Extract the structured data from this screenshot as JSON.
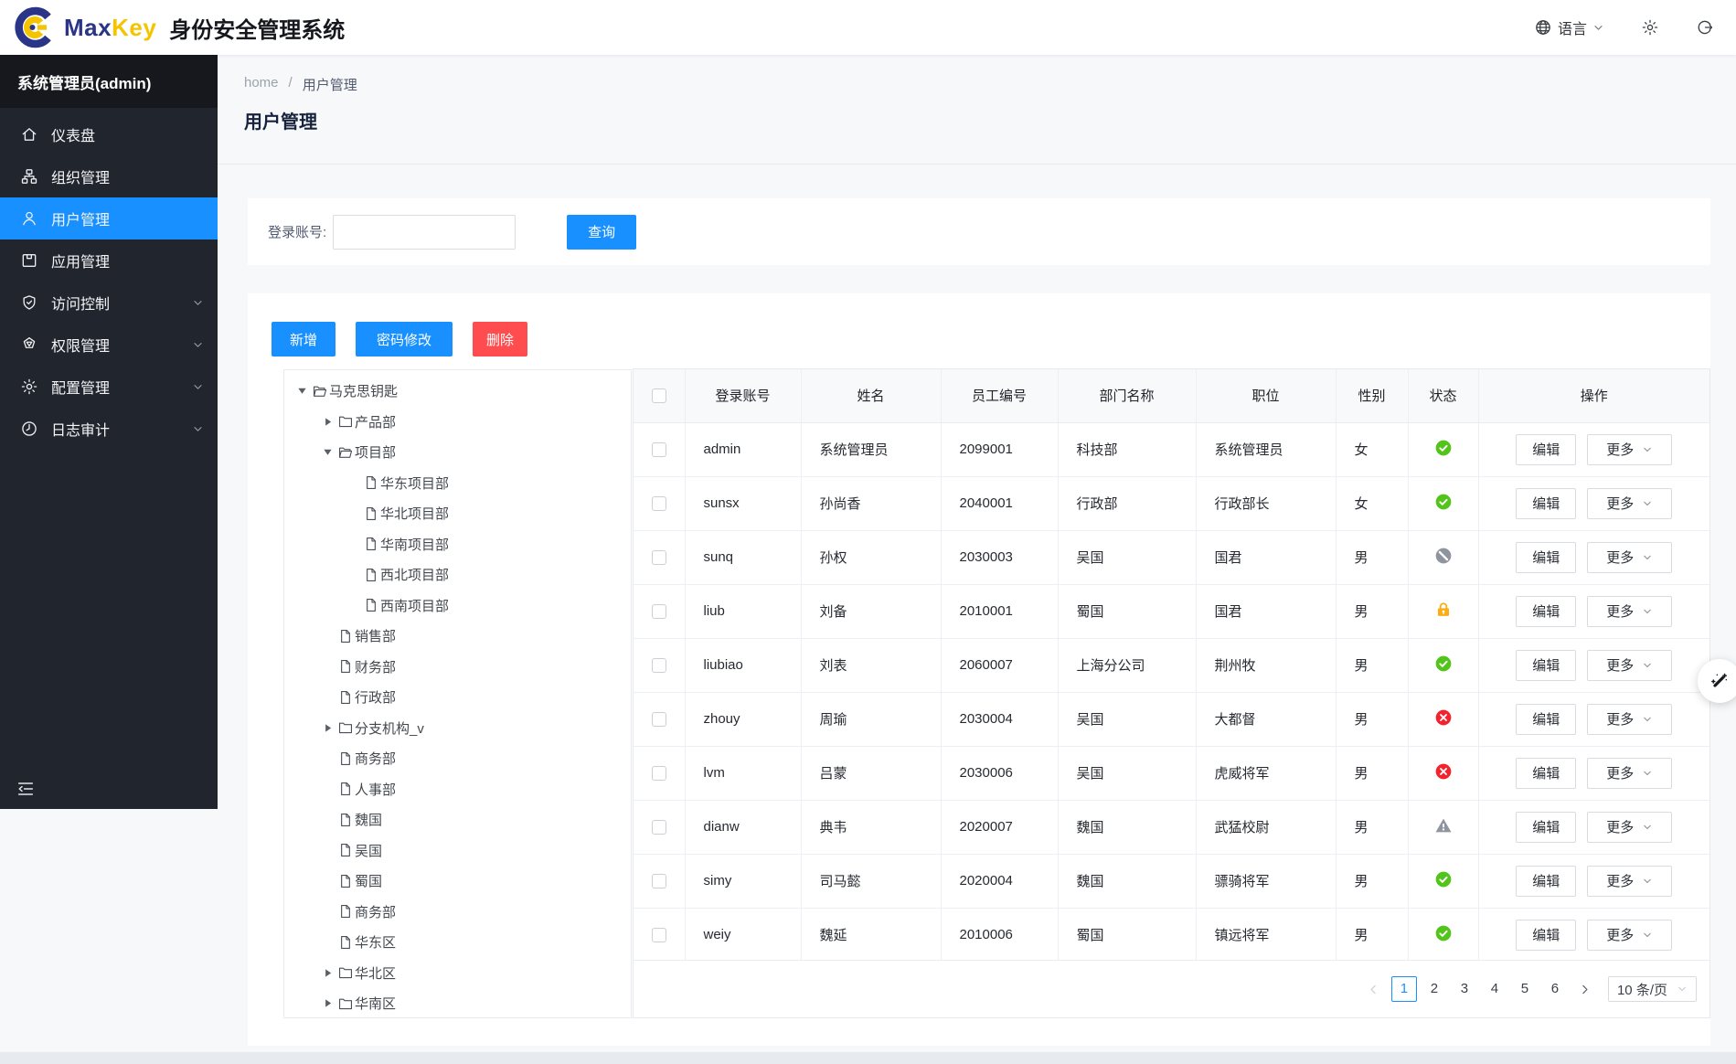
{
  "header": {
    "brand": {
      "max": "Max",
      "key": "Key",
      "product": "身份安全管理系统"
    },
    "language": {
      "label": "语言"
    }
  },
  "sidebar": {
    "user_title": "系统管理员(admin)",
    "items": [
      {
        "label": "仪表盘",
        "icon": "dashboard-icon",
        "active": false,
        "chevron": false
      },
      {
        "label": "组织管理",
        "icon": "organization-icon",
        "active": false,
        "chevron": false
      },
      {
        "label": "用户管理",
        "icon": "user-icon",
        "active": true,
        "chevron": false
      },
      {
        "label": "应用管理",
        "icon": "app-icon",
        "active": false,
        "chevron": false
      },
      {
        "label": "访问控制",
        "icon": "shield-icon",
        "active": false,
        "chevron": true
      },
      {
        "label": "权限管理",
        "icon": "gem-icon",
        "active": false,
        "chevron": true
      },
      {
        "label": "配置管理",
        "icon": "config-gear-icon",
        "active": false,
        "chevron": true
      },
      {
        "label": "日志审计",
        "icon": "clock-icon",
        "active": false,
        "chevron": true
      }
    ]
  },
  "breadcrumb": {
    "home": "home",
    "separator": "/",
    "current": "用户管理"
  },
  "page_title": "用户管理",
  "search": {
    "label": "登录账号:",
    "input_value": "",
    "button": "查询"
  },
  "toolbar": [
    {
      "label": "新增",
      "type": "primary"
    },
    {
      "label": "密码修改",
      "type": "primary"
    },
    {
      "label": "删除",
      "type": "danger"
    }
  ],
  "tree": {
    "nodes": [
      {
        "label": "马克思钥匙",
        "level": 0,
        "caret": "open",
        "icon": "folder-open-icon"
      },
      {
        "label": "产品部",
        "level": 1,
        "caret": "closed",
        "icon": "folder-closed-icon"
      },
      {
        "label": "项目部",
        "level": 1,
        "caret": "open",
        "icon": "folder-open-icon"
      },
      {
        "label": "华东项目部",
        "level": 2,
        "caret": "none",
        "icon": "file-icon"
      },
      {
        "label": "华北项目部",
        "level": 2,
        "caret": "none",
        "icon": "file-icon"
      },
      {
        "label": "华南项目部",
        "level": 2,
        "caret": "none",
        "icon": "file-icon"
      },
      {
        "label": "西北项目部",
        "level": 2,
        "caret": "none",
        "icon": "file-icon"
      },
      {
        "label": "西南项目部",
        "level": 2,
        "caret": "none",
        "icon": "file-icon"
      },
      {
        "label": "销售部",
        "level": 1,
        "caret": "none",
        "icon": "file-icon"
      },
      {
        "label": "财务部",
        "level": 1,
        "caret": "none",
        "icon": "file-icon"
      },
      {
        "label": "行政部",
        "level": 1,
        "caret": "none",
        "icon": "file-icon"
      },
      {
        "label": "分支机构_v",
        "level": 1,
        "caret": "closed",
        "icon": "folder-closed-icon"
      },
      {
        "label": "商务部",
        "level": 1,
        "caret": "none",
        "icon": "file-icon"
      },
      {
        "label": "人事部",
        "level": 1,
        "caret": "none",
        "icon": "file-icon"
      },
      {
        "label": "魏国",
        "level": 1,
        "caret": "none",
        "icon": "file-icon"
      },
      {
        "label": "吴国",
        "level": 1,
        "caret": "none",
        "icon": "file-icon"
      },
      {
        "label": "蜀国",
        "level": 1,
        "caret": "none",
        "icon": "file-icon"
      },
      {
        "label": "商务部",
        "level": 1,
        "caret": "none",
        "icon": "file-icon"
      },
      {
        "label": "华东区",
        "level": 1,
        "caret": "none",
        "icon": "file-icon"
      },
      {
        "label": "华北区",
        "level": 1,
        "caret": "closed",
        "icon": "folder-closed-icon"
      },
      {
        "label": "华南区",
        "level": 1,
        "caret": "closed",
        "icon": "folder-closed-icon"
      }
    ]
  },
  "table": {
    "headers": [
      "登录账号",
      "姓名",
      "员工编号",
      "部门名称",
      "职位",
      "性别",
      "状态",
      "操作"
    ],
    "edit_label": "编辑",
    "more_label": "更多",
    "rows": [
      {
        "account": "admin",
        "name": "系统管理员",
        "employee_no": "2099001",
        "department": "科技部",
        "position": "系统管理员",
        "gender": "女",
        "status": "active"
      },
      {
        "account": "sunsx",
        "name": "孙尚香",
        "employee_no": "2040001",
        "department": "行政部",
        "position": "行政部长",
        "gender": "女",
        "status": "active"
      },
      {
        "account": "sunq",
        "name": "孙权",
        "employee_no": "2030003",
        "department": "吴国",
        "position": "国君",
        "gender": "男",
        "status": "disabled"
      },
      {
        "account": "liub",
        "name": "刘备",
        "employee_no": "2010001",
        "department": "蜀国",
        "position": "国君",
        "gender": "男",
        "status": "locked"
      },
      {
        "account": "liubiao",
        "name": "刘表",
        "employee_no": "2060007",
        "department": "上海分公司",
        "position": "荆州牧",
        "gender": "男",
        "status": "active"
      },
      {
        "account": "zhouy",
        "name": "周瑜",
        "employee_no": "2030004",
        "department": "吴国",
        "position": "大都督",
        "gender": "男",
        "status": "inactive"
      },
      {
        "account": "lvm",
        "name": "吕蒙",
        "employee_no": "2030006",
        "department": "吴国",
        "position": "虎威将军",
        "gender": "男",
        "status": "inactive"
      },
      {
        "account": "dianw",
        "name": "典韦",
        "employee_no": "2020007",
        "department": "魏国",
        "position": "武猛校尉",
        "gender": "男",
        "status": "warning"
      },
      {
        "account": "simy",
        "name": "司马懿",
        "employee_no": "2020004",
        "department": "魏国",
        "position": "骠骑将军",
        "gender": "男",
        "status": "active"
      },
      {
        "account": "weiy",
        "name": "魏延",
        "employee_no": "2010006",
        "department": "蜀国",
        "position": "镇远将军",
        "gender": "男",
        "status": "active"
      }
    ]
  },
  "pagination": {
    "pages": [
      "1",
      "2",
      "3",
      "4",
      "5",
      "6"
    ],
    "active_page": "1",
    "page_size": "10 条/页"
  },
  "colors": {
    "primary": "#1890ff",
    "danger": "#ff4d4f",
    "status_active": "#52c41a",
    "status_inactive": "#f5222d",
    "status_locked": "#faad14",
    "status_muted": "#8f959e",
    "sidebar_bg": "#21252d",
    "sidebar_header_bg": "#16181d",
    "brand_navy": "#2a3588",
    "brand_gold": "#f5c400"
  }
}
